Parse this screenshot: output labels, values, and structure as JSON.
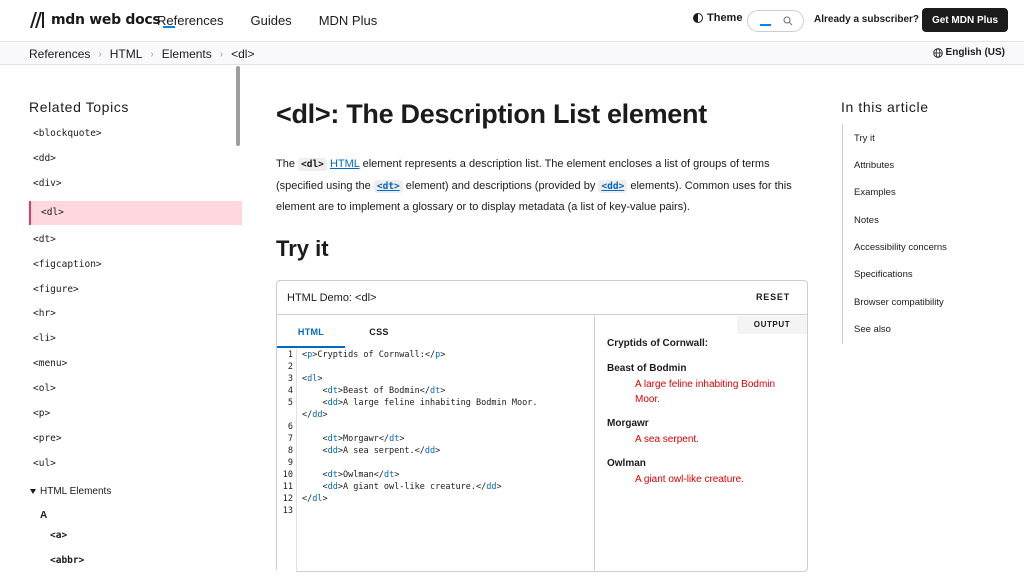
{
  "topnav": {
    "logo_text": "mdn web docs",
    "nav": [
      "References",
      "Guides",
      "MDN Plus"
    ],
    "theme_label": "Theme",
    "subscriber_label": "Already a subscriber?",
    "get_plus_label": "Get MDN Plus"
  },
  "breadcrumb": {
    "items": [
      "References",
      "HTML",
      "Elements",
      "<dl>"
    ],
    "language": "English (US)"
  },
  "sidebar": {
    "heading": "Related Topics",
    "items": [
      "<blockquote>",
      "<dd>",
      "<div>",
      "<dl>",
      "<dt>",
      "<figcaption>",
      "<figure>",
      "<hr>",
      "<li>",
      "<menu>",
      "<ol>",
      "<p>",
      "<pre>",
      "<ul>"
    ],
    "active_index": 3,
    "group_label": "HTML Elements",
    "subgroup_label": "A",
    "sub_items": [
      "<a>",
      "<abbr>"
    ]
  },
  "main": {
    "title": "<dl>: The Description List element",
    "intro": {
      "t1": "The ",
      "c1": "<dl>",
      "l1": "HTML",
      "t2": " element represents a description list. The element encloses a list of groups of terms (specified using the ",
      "c2": "<dt>",
      "t3": " element) and descriptions (provided by ",
      "c3": "<dd>",
      "t4": " elements). Common uses for this element are to implement a glossary or to display metadata (a list of key-value pairs)."
    },
    "try_heading": "Try it"
  },
  "demo": {
    "title": "HTML Demo: <dl>",
    "reset_label": "RESET",
    "tabs": [
      "HTML",
      "CSS"
    ],
    "active_tab": 0,
    "line_numbers": [
      "1",
      "2",
      "3",
      "4",
      "5",
      "",
      "6",
      "7",
      "8",
      "9",
      "10",
      "11",
      "12",
      "13"
    ],
    "code_lines": [
      "<p>Cryptids of Cornwall:</p>",
      "",
      "<dl>",
      "    <dt>Beast of Bodmin</dt>",
      "    <dd>A large feline inhabiting Bodmin Moor.",
      "</dd>",
      "",
      "    <dt>Morgawr</dt>",
      "    <dd>A sea serpent.</dd>",
      "",
      "    <dt>Owlman</dt>",
      "    <dd>A giant owl-like creature.</dd>",
      "</dl>",
      ""
    ],
    "output_label": "OUTPUT",
    "output_p": "Cryptids of Cornwall:",
    "output_terms": [
      {
        "dt": "Beast of Bodmin",
        "dd": "A large feline inhabiting Bodmin Moor."
      },
      {
        "dt": "Morgawr",
        "dd": "A sea serpent."
      },
      {
        "dt": "Owlman",
        "dd": "A giant owl-like creature."
      }
    ]
  },
  "toc": {
    "heading": "In this article",
    "items": [
      "Try it",
      "Attributes",
      "Examples",
      "Notes",
      "Accessibility concerns",
      "Specifications",
      "Browser compatibility",
      "See also"
    ]
  },
  "colors": {
    "accent": "#0069c2",
    "active_bg": "#ffd8df",
    "active_border": "#e6386a",
    "output_dd": "#e10000"
  }
}
